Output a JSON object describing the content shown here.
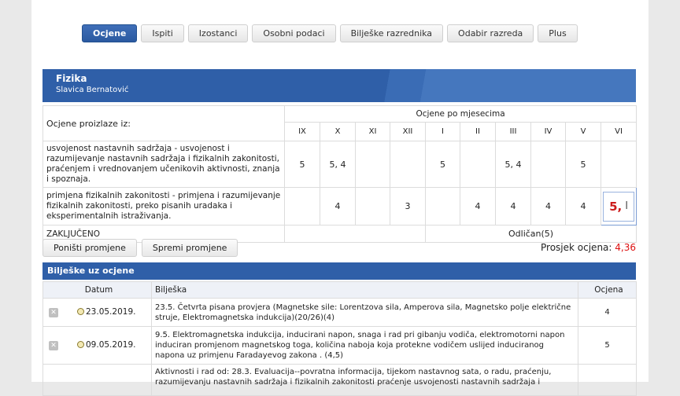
{
  "tabs": [
    "Ocjene",
    "Ispiti",
    "Izostanci",
    "Osobni podaci",
    "Bilješke razrednika",
    "Odabir razreda",
    "Plus"
  ],
  "subject": {
    "name": "Fizika",
    "teacher": "Slavica Bernatović"
  },
  "grades": {
    "source_label": "Ocjene proizlaze iz:",
    "months_label": "Ocjene po mjesecima",
    "months": [
      "IX",
      "X",
      "XI",
      "XII",
      "I",
      "II",
      "III",
      "IV",
      "V",
      "VI"
    ],
    "rows": [
      {
        "criterion": "usvojenost nastavnih sadržaja - usvojenost i razumijevanje nastavnih sadržaja i fizikalnih zakonitosti, praćenjem i vrednovanjem učenikovih aktivnosti, znanja i spoznaja.",
        "values": [
          "5",
          "5, 4",
          "",
          "",
          "5",
          "",
          "5, 4",
          "",
          "5",
          ""
        ]
      },
      {
        "criterion": "primjena fizikalnih zakonitosti - primjena i razumijevanje fizikalnih zakonitosti, preko pisanih uradaka i eksperimentalnih istraživanja.",
        "values": [
          "",
          "4",
          "",
          "3",
          "",
          "4",
          "4",
          "4",
          "4",
          "5,"
        ]
      }
    ],
    "conclusion_label": "ZAKLJUČENO",
    "final_grade": "Odličan(5)"
  },
  "buttons": {
    "cancel": "Poništi promjene",
    "save": "Spremi promjene"
  },
  "average": {
    "label": "Prosjek ocjena:",
    "value": "4,36"
  },
  "notes": {
    "title": "Bilješke uz ocjene",
    "headers": {
      "date": "Datum",
      "note": "Bilješka",
      "grade": "Ocjena"
    },
    "rows": [
      {
        "date": "23.05.2019.",
        "note": "23.5. Četvrta pisana provjera (Magnetske sile: Lorentzova sila, Amperova sila, Magnetsko polje električne struje, Elektromagnetska indukcija)(20/26)(4)",
        "grade": "4"
      },
      {
        "date": "09.05.2019.",
        "note": "9.5. Elektromagnetska indukcija, inducirani napon, snaga i rad pri gibanju vodiča, elektromotorni napon induciran promjenom magnetskog toga, količina naboja koja protekne vodičem uslijed induciranog napona uz primjenu Faradayevog zakona . (4,5)",
        "grade": "5"
      },
      {
        "date": "",
        "note": "Aktivnosti i rad od: 28.3. Evaluacija--povratna informacija, tijekom nastavnog sata, o radu, praćenju, razumijevanju nastavnih sadržaja i fizikalnih zakonitosti praćenje usvojenosti nastavnih sadržaja i",
        "grade": ""
      }
    ]
  }
}
